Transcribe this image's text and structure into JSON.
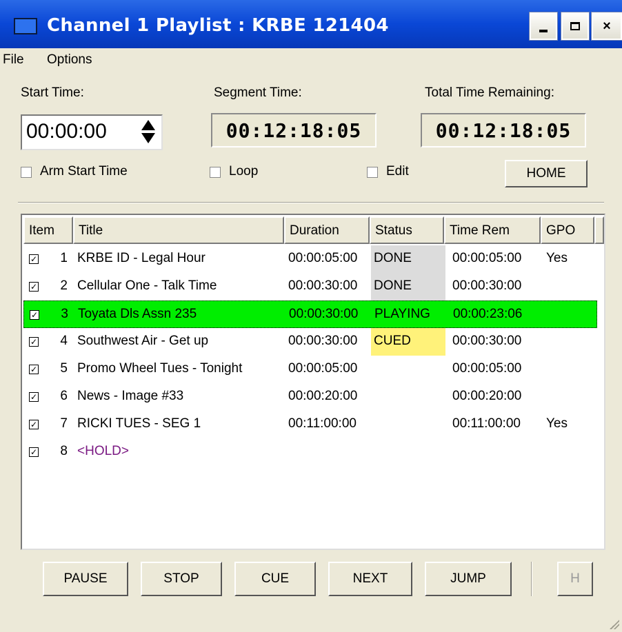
{
  "window": {
    "title": "Channel 1 Playlist : KRBE 121404"
  },
  "title_buttons": {
    "minimize": "-",
    "maximize": "",
    "close": "×"
  },
  "menu": [
    "File",
    "Options"
  ],
  "labels": {
    "start_time": "Start Time:",
    "segment_time": "Segment Time:",
    "total_time_remaining": "Total Time Remaining:"
  },
  "start_time_value": "00:00:00",
  "segment_time_display": "00:12:18:05",
  "total_remaining_display": "00:12:18:05",
  "options": {
    "arm_start_time": "Arm Start Time",
    "loop": "Loop",
    "edit": "Edit",
    "home_button": "HOME"
  },
  "table": {
    "columns": [
      "Item",
      "Title",
      "Duration",
      "Status",
      "Time Rem",
      "GPO"
    ],
    "rows": [
      {
        "checked": true,
        "item": "1",
        "title": "KRBE ID - Legal Hour",
        "duration": "00:00:05:00",
        "status": "DONE",
        "time_rem": "00:00:05:00",
        "gpo": "Yes"
      },
      {
        "checked": true,
        "item": "2",
        "title": "Cellular One - Talk Time",
        "duration": "00:00:30:00",
        "status": "DONE",
        "time_rem": "00:00:30:00",
        "gpo": ""
      },
      {
        "checked": true,
        "item": "3",
        "title": "Toyata Dls Assn 235",
        "duration": "00:00:30:00",
        "status": "PLAYING",
        "time_rem": "00:00:23:06",
        "gpo": ""
      },
      {
        "checked": true,
        "item": "4",
        "title": "Southwest Air - Get up",
        "duration": "00:00:30:00",
        "status": "CUED",
        "time_rem": "00:00:30:00",
        "gpo": ""
      },
      {
        "checked": true,
        "item": "5",
        "title": "Promo Wheel Tues - Tonight",
        "duration": "00:00:05:00",
        "status": "",
        "time_rem": "00:00:05:00",
        "gpo": ""
      },
      {
        "checked": true,
        "item": "6",
        "title": "News - Image #33",
        "duration": "00:00:20:00",
        "status": "",
        "time_rem": "00:00:20:00",
        "gpo": ""
      },
      {
        "checked": true,
        "item": "7",
        "title": "RICKI TUES - SEG 1",
        "duration": "00:11:00:00",
        "status": "",
        "time_rem": "00:11:00:00",
        "gpo": "Yes"
      },
      {
        "checked": true,
        "item": "8",
        "title": "<HOLD>",
        "duration": "",
        "status": "",
        "time_rem": "",
        "gpo": ""
      }
    ]
  },
  "transport_buttons": {
    "pause": "PAUSE",
    "stop": "STOP",
    "cue": "CUE",
    "next": "NEXT",
    "jump": "JUMP",
    "h": "H"
  },
  "colors": {
    "title_bar": "#0a47d6",
    "playing_row": "#00ee00",
    "cued_status": "#fff27a",
    "done_status": "#dcdcdc",
    "hold_text": "#7b1a83"
  },
  "icons": {
    "window_icon": "window-icon",
    "spinner": "spinner-arrows-icon",
    "check": "checkbox-checked-icon"
  }
}
